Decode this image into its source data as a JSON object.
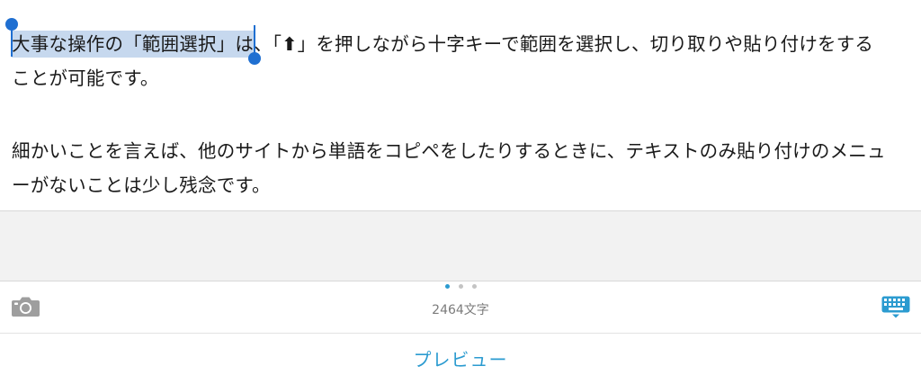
{
  "editor": {
    "para1": {
      "selected": "大事な操作の「範囲選択」は",
      "rest_line1_a": "、「",
      "arrow": "⬆",
      "rest_line1_b": "」を押しながら十字キーで範囲を選択し、切り取りや貼り付けをする",
      "line2": "ことが可能です。"
    },
    "para2": {
      "line1": "細かいことを言えば、他のサイトから単語をコピペをしたりするときに、テキストのみ貼り付けのメニュ",
      "line2": "ーがないことは少し残念です。"
    }
  },
  "toolbar": {
    "char_count": "2464文字",
    "page_dots": 3,
    "active_dot": 0,
    "camera_icon": "camera-icon",
    "keyboard_icon": "keyboard-dismiss-icon",
    "accent_color": "#2b9bd0"
  },
  "bottom": {
    "preview_label": "プレビュー"
  }
}
